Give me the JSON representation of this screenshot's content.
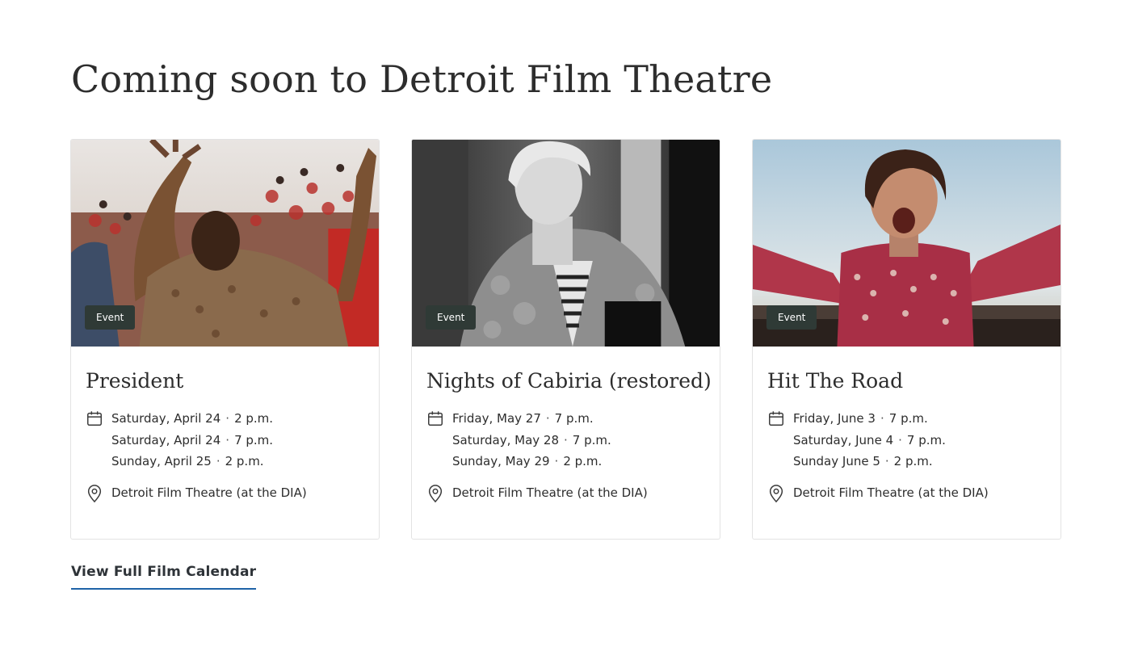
{
  "heading": "Coming soon to Detroit Film Theatre",
  "cards": [
    {
      "badge": "Event",
      "title": "President",
      "showtimes": [
        {
          "day": "Saturday, April 24",
          "time": "2 p.m."
        },
        {
          "day": "Saturday, April 24",
          "time": "7 p.m."
        },
        {
          "day": "Sunday, April 25",
          "time": "2 p.m."
        }
      ],
      "location": "Detroit Film Theatre (at the DIA)"
    },
    {
      "badge": "Event",
      "title": "Nights of Cabiria (restored)",
      "showtimes": [
        {
          "day": "Friday, May 27",
          "time": "7 p.m."
        },
        {
          "day": "Saturday, May 28",
          "time": "7 p.m."
        },
        {
          "day": "Sunday, May 29",
          "time": "2 p.m."
        }
      ],
      "location": "Detroit Film Theatre (at the DIA)"
    },
    {
      "badge": "Event",
      "title": "Hit The Road",
      "showtimes": [
        {
          "day": "Friday, June 3",
          "time": "7 p.m."
        },
        {
          "day": "Saturday, June 4",
          "time": "7 p.m."
        },
        {
          "day": "Sunday June 5",
          "time": "2 p.m."
        }
      ],
      "location": "Detroit Film Theatre (at the DIA)"
    }
  ],
  "separator": "·",
  "calendar_link": "View Full Film Calendar",
  "icons": {
    "date": "calendar-icon",
    "location": "map-pin-icon"
  },
  "colors": {
    "badge_bg": "#2f3a36",
    "link_underline": "#1f63a8",
    "text": "#2d2d2d",
    "card_border": "#e3e3e3"
  }
}
